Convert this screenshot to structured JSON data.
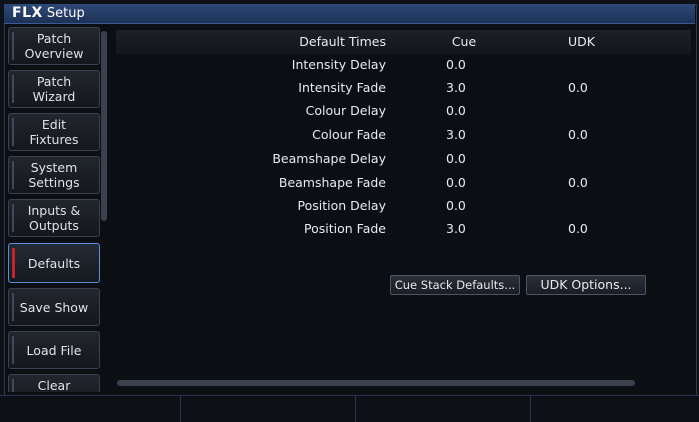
{
  "window": {
    "title_brand": "FLX",
    "title_text": "Setup"
  },
  "sidebar": {
    "items": [
      {
        "label_line1": "Patch",
        "label_line2": "Overview",
        "active": false
      },
      {
        "label_line1": "Patch",
        "label_line2": "Wizard",
        "active": false
      },
      {
        "label_line1": "Edit",
        "label_line2": "Fixtures",
        "active": false
      },
      {
        "label_line1": "System",
        "label_line2": "Settings",
        "active": false
      },
      {
        "label_line1": "Inputs &",
        "label_line2": "Outputs",
        "active": false
      },
      {
        "label_line1": "Defaults",
        "label_line2": "",
        "active": true
      },
      {
        "label_line1": "Save Show",
        "label_line2": "",
        "active": false
      },
      {
        "label_line1": "Load File",
        "label_line2": "",
        "active": false
      },
      {
        "label_line1": "Clear",
        "label_line2": "",
        "active": false
      }
    ]
  },
  "table": {
    "header": {
      "label": "Default Times",
      "cue": "Cue",
      "udk": "UDK"
    },
    "rows": [
      {
        "label": "Intensity Delay",
        "cue": "0.0",
        "udk": ""
      },
      {
        "label": "Intensity Fade",
        "cue": "3.0",
        "udk": "0.0"
      },
      {
        "label": "Colour Delay",
        "cue": "0.0",
        "udk": ""
      },
      {
        "label": "Colour Fade",
        "cue": "3.0",
        "udk": "0.0"
      },
      {
        "label": "Beamshape Delay",
        "cue": "0.0",
        "udk": ""
      },
      {
        "label": "Beamshape Fade",
        "cue": "0.0",
        "udk": "0.0"
      },
      {
        "label": "Position Delay",
        "cue": "0.0",
        "udk": ""
      },
      {
        "label": "Position Fade",
        "cue": "3.0",
        "udk": "0.0"
      }
    ]
  },
  "buttons": {
    "cue_stack_defaults": "Cue Stack Defaults...",
    "udk_options": "UDK Options..."
  },
  "colors": {
    "accent": "#5a8fd8",
    "active_marker": "#c0242c",
    "title_bar": "#2f4a78"
  }
}
